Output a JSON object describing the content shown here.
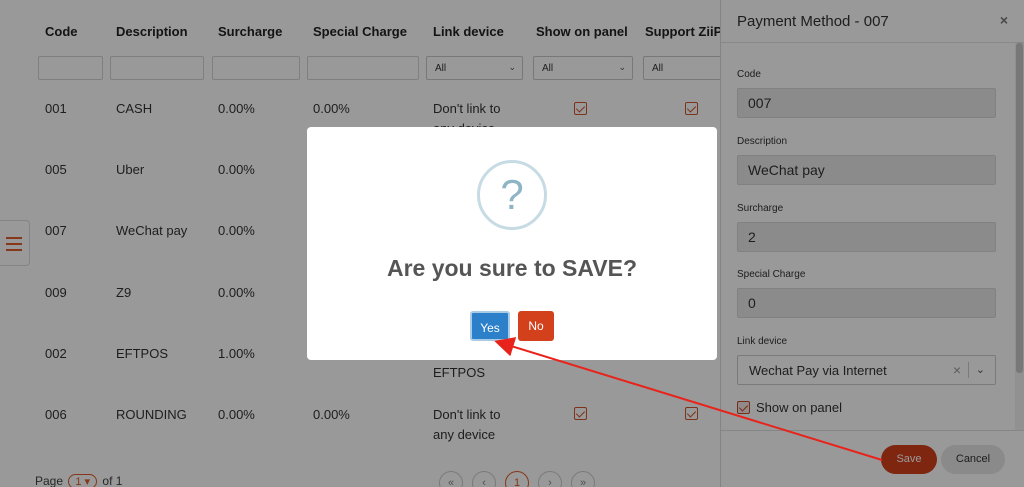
{
  "table": {
    "headers": {
      "code": "Code",
      "description": "Description",
      "surcharge": "Surcharge",
      "special_charge": "Special Charge",
      "link_device": "Link device",
      "show_on_panel": "Show on panel",
      "support": "Support ZiiP"
    },
    "filters": {
      "link_device": "All",
      "show_on_panel": "All",
      "support": "All"
    },
    "rows": [
      {
        "code": "001",
        "description": "CASH",
        "surcharge": "0.00%",
        "special_charge": "0.00%",
        "link_line1": "Don't link to",
        "link_line2": "any device"
      },
      {
        "code": "005",
        "description": "Uber",
        "surcharge": "0.00%",
        "special_charge": "",
        "link_line1": "",
        "link_line2": ""
      },
      {
        "code": "007",
        "description": "WeChat pay",
        "surcharge": "0.00%",
        "special_charge": "",
        "link_line1": "",
        "link_line2": ""
      },
      {
        "code": "009",
        "description": "Z9",
        "surcharge": "0.00%",
        "special_charge": "",
        "link_line1": "",
        "link_line2": ""
      },
      {
        "code": "002",
        "description": "EFTPOS",
        "surcharge": "1.00%",
        "special_charge": "",
        "link_line1": "",
        "link_line2": "EFTPOS"
      },
      {
        "code": "006",
        "description": "ROUNDING",
        "surcharge": "0.00%",
        "special_charge": "0.00%",
        "link_line1": "Don't link to",
        "link_line2": "any device"
      }
    ],
    "pager": {
      "prefix": "Page",
      "current": "1",
      "suffix": "of 1"
    },
    "pager_buttons": [
      "«",
      "‹",
      "1",
      "›",
      "»"
    ]
  },
  "panel": {
    "title": "Payment Method - 007",
    "close": "×",
    "fields": {
      "code": {
        "label": "Code",
        "value": "007"
      },
      "description": {
        "label": "Description",
        "value": "WeChat pay"
      },
      "surcharge": {
        "label": "Surcharge",
        "value": "2"
      },
      "special_charge": {
        "label": "Special Charge",
        "value": "0"
      },
      "link_device": {
        "label": "Link device",
        "value": "Wechat Pay via Internet"
      }
    },
    "show_on_panel": "Show on panel",
    "save": "Save",
    "cancel": "Cancel"
  },
  "dialog": {
    "icon": "?",
    "title": "Are you sure to SAVE?",
    "yes": "Yes",
    "no": "No"
  },
  "colors": {
    "accent": "#d2401c",
    "primary": "#2c7fc9"
  }
}
